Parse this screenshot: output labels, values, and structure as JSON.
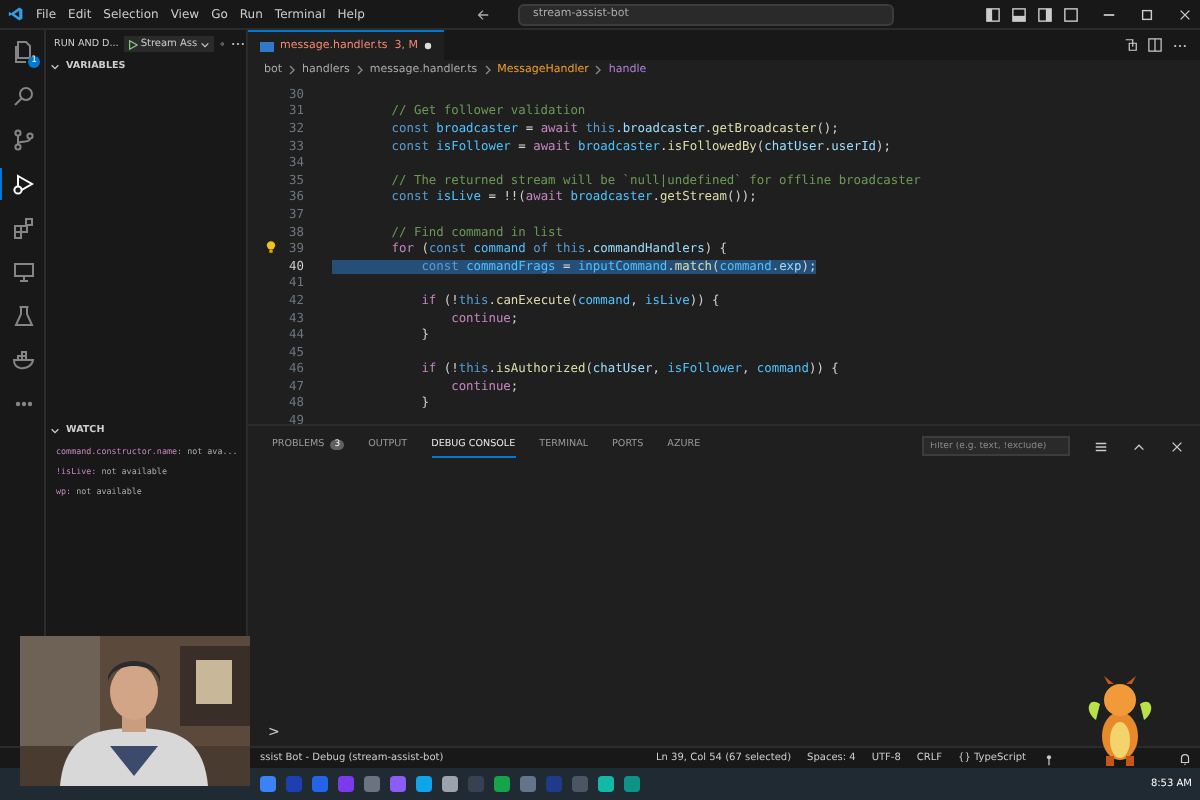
{
  "title_bar": {
    "menus": [
      "File",
      "Edit",
      "Selection",
      "View",
      "Go",
      "Run",
      "Terminal",
      "Help"
    ],
    "search": "stream-assist-bot"
  },
  "activity_bar": {
    "items": [
      {
        "kind": "files",
        "selected": false,
        "badge": "1"
      },
      {
        "kind": "search",
        "selected": false
      },
      {
        "kind": "scm",
        "selected": false
      },
      {
        "kind": "debug",
        "selected": true
      },
      {
        "kind": "extensions",
        "selected": false
      },
      {
        "kind": "remote",
        "selected": false
      },
      {
        "kind": "test",
        "selected": false
      },
      {
        "kind": "docker",
        "selected": false
      },
      {
        "kind": "more",
        "selected": false
      }
    ]
  },
  "sidebar": {
    "title": "RUN AND D...",
    "config": "Stream Ass",
    "sections": [
      {
        "title": "VARIABLES",
        "expanded": true
      },
      {
        "title": "WATCH",
        "expanded": true,
        "items": [
          {
            "name": "command.constructor.name:",
            "value": "not ava..."
          },
          {
            "name": "!isLive:",
            "value": "not available"
          },
          {
            "name": "wp:",
            "value": "not available"
          }
        ]
      }
    ]
  },
  "tabs": [
    {
      "label": "message.handler.ts",
      "status": "3, M",
      "modified": true,
      "selected": true
    }
  ],
  "breadcrumbs": [
    {
      "kind": "folder",
      "label": "bot"
    },
    {
      "kind": "folder",
      "label": "handlers"
    },
    {
      "kind": "file",
      "label": "message.handler.ts"
    },
    {
      "kind": "class",
      "label": "MessageHandler"
    },
    {
      "kind": "method",
      "label": "handle"
    }
  ],
  "code": {
    "lines": [
      {
        "number": "30",
        "selected": false
      },
      {
        "number": "31",
        "selected": false,
        "tokens": [
          {
            "t": "        // Get follower validation",
            "kind": "cm"
          }
        ]
      },
      {
        "number": "32",
        "selected": false,
        "tokens": [
          {
            "t": "        const ",
            "kind": "kw"
          },
          {
            "t": "broadcaster",
            "kind": "const"
          },
          {
            "t": " = ",
            "kind": "p"
          },
          {
            "t": "await ",
            "kind": "ctl"
          },
          {
            "t": "this",
            "kind": "kw"
          },
          {
            "t": ".",
            "kind": "p"
          },
          {
            "t": "broadcaster",
            "kind": "var"
          },
          {
            "t": ".",
            "kind": "p"
          },
          {
            "t": "getBroadcaster",
            "kind": "fn"
          },
          {
            "t": "();",
            "kind": "p"
          }
        ]
      },
      {
        "number": "33",
        "selected": false,
        "tokens": [
          {
            "t": "        const ",
            "kind": "kw"
          },
          {
            "t": "isFollower",
            "kind": "const"
          },
          {
            "t": " = ",
            "kind": "p"
          },
          {
            "t": "await ",
            "kind": "ctl"
          },
          {
            "t": "broadcaster",
            "kind": "const"
          },
          {
            "t": ".",
            "kind": "p"
          },
          {
            "t": "isFollowedBy",
            "kind": "fn"
          },
          {
            "t": "(",
            "kind": "p"
          },
          {
            "t": "chatUser",
            "kind": "var"
          },
          {
            "t": ".",
            "kind": "p"
          },
          {
            "t": "userId",
            "kind": "var"
          },
          {
            "t": ");",
            "kind": "p"
          }
        ]
      },
      {
        "number": "34",
        "selected": false
      },
      {
        "number": "35",
        "selected": false,
        "tokens": [
          {
            "t": "        // The returned stream will be `null|undefined` for offline broadcaster",
            "kind": "cm"
          }
        ]
      },
      {
        "number": "36",
        "selected": false,
        "tokens": [
          {
            "t": "        const ",
            "kind": "kw"
          },
          {
            "t": "isLive",
            "kind": "const"
          },
          {
            "t": " = !!(",
            "kind": "p"
          },
          {
            "t": "await ",
            "kind": "ctl"
          },
          {
            "t": "broadcaster",
            "kind": "const"
          },
          {
            "t": ".",
            "kind": "p"
          },
          {
            "t": "getStream",
            "kind": "fn"
          },
          {
            "t": "());",
            "kind": "p"
          }
        ]
      },
      {
        "number": "37",
        "selected": false
      },
      {
        "number": "38",
        "selected": false,
        "tokens": [
          {
            "t": "        // Find command in list",
            "kind": "cm"
          }
        ]
      },
      {
        "number": "39",
        "selected": false,
        "hint": true,
        "tokens": [
          {
            "t": "        for ",
            "kind": "ctl"
          },
          {
            "t": "(",
            "kind": "p"
          },
          {
            "t": "const ",
            "kind": "kw"
          },
          {
            "t": "command",
            "kind": "const"
          },
          {
            "t": " of ",
            "kind": "kw"
          },
          {
            "t": "this",
            "kind": "kw"
          },
          {
            "t": ".",
            "kind": "p"
          },
          {
            "t": "commandHandlers",
            "kind": "var"
          },
          {
            "t": ") {",
            "kind": "p"
          }
        ]
      },
      {
        "number": "40",
        "selected": true,
        "tokens": [
          {
            "t": "            const ",
            "kind": "kw"
          },
          {
            "t": "commandFrags",
            "kind": "const"
          },
          {
            "t": " = ",
            "kind": "p"
          },
          {
            "t": "inputCommand",
            "kind": "const"
          },
          {
            "t": ".",
            "kind": "p"
          },
          {
            "t": "match",
            "kind": "fn"
          },
          {
            "t": "(",
            "kind": "p"
          },
          {
            "t": "command",
            "kind": "const"
          },
          {
            "t": ".",
            "kind": "p"
          },
          {
            "t": "exp",
            "kind": "var"
          },
          {
            "t": ");",
            "kind": "p"
          }
        ]
      },
      {
        "number": "41",
        "selected": false
      },
      {
        "number": "42",
        "selected": false,
        "tokens": [
          {
            "t": "            if ",
            "kind": "ctl"
          },
          {
            "t": "(!",
            "kind": "p"
          },
          {
            "t": "this",
            "kind": "kw"
          },
          {
            "t": ".",
            "kind": "p"
          },
          {
            "t": "canExecute",
            "kind": "fn"
          },
          {
            "t": "(",
            "kind": "p"
          },
          {
            "t": "command",
            "kind": "const"
          },
          {
            "t": ", ",
            "kind": "p"
          },
          {
            "t": "isLive",
            "kind": "const"
          },
          {
            "t": ")) {",
            "kind": "p"
          }
        ]
      },
      {
        "number": "43",
        "selected": false,
        "tokens": [
          {
            "t": "                continue",
            "kind": "ctl"
          },
          {
            "t": ";",
            "kind": "p"
          }
        ]
      },
      {
        "number": "44",
        "selected": false,
        "tokens": [
          {
            "t": "            }",
            "kind": "p"
          }
        ]
      },
      {
        "number": "45",
        "selected": false
      },
      {
        "number": "46",
        "selected": false,
        "tokens": [
          {
            "t": "            if ",
            "kind": "ctl"
          },
          {
            "t": "(!",
            "kind": "p"
          },
          {
            "t": "this",
            "kind": "kw"
          },
          {
            "t": ".",
            "kind": "p"
          },
          {
            "t": "isAuthorized",
            "kind": "fn"
          },
          {
            "t": "(",
            "kind": "p"
          },
          {
            "t": "chatUser",
            "kind": "var"
          },
          {
            "t": ", ",
            "kind": "p"
          },
          {
            "t": "isFollower",
            "kind": "const"
          },
          {
            "t": ", ",
            "kind": "p"
          },
          {
            "t": "command",
            "kind": "const"
          },
          {
            "t": ")) {",
            "kind": "p"
          }
        ]
      },
      {
        "number": "47",
        "selected": false,
        "tokens": [
          {
            "t": "                continue",
            "kind": "ctl"
          },
          {
            "t": ";",
            "kind": "p"
          }
        ]
      },
      {
        "number": "48",
        "selected": false,
        "tokens": [
          {
            "t": "            }",
            "kind": "p"
          }
        ]
      },
      {
        "number": "49",
        "selected": false
      }
    ]
  },
  "panel": {
    "tabs": [
      {
        "label": "PROBLEMS",
        "badge": "3",
        "selected": false
      },
      {
        "label": "OUTPUT",
        "selected": false
      },
      {
        "label": "DEBUG CONSOLE",
        "selected": true
      },
      {
        "label": "TERMINAL",
        "selected": false
      },
      {
        "label": "PORTS",
        "selected": false
      },
      {
        "label": "AZURE",
        "selected": false
      }
    ],
    "filter_placeholder": "Filter (e.g. text, !exclude)",
    "prompt": ">"
  },
  "status_bar": {
    "left": "ssist Bot - Debug (stream-assist-bot)",
    "right": [
      "Ln 39, Col 54 (67 selected)",
      "Spaces: 4",
      "UTF-8",
      "CRLF",
      "{} TypeScript"
    ]
  },
  "taskbar": {
    "time": "8:53 AM"
  }
}
